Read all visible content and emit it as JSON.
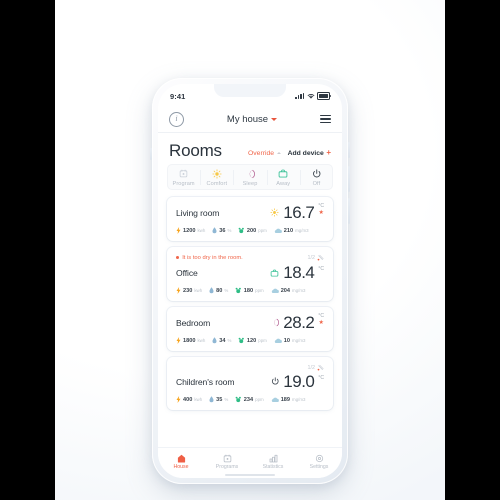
{
  "status_bar": {
    "time": "9:41",
    "signal_icon": "cellular-bars-icon",
    "wifi_icon": "wifi-icon",
    "battery_icon": "battery-icon"
  },
  "app_header": {
    "info_icon": "info-icon",
    "info_glyph": "i",
    "title": "My house",
    "chevron_icon": "chevron-down-icon",
    "menu_icon": "hamburger-menu-icon"
  },
  "page": {
    "title": "Rooms",
    "override_label": "Override",
    "override_chevron": "chevron-up-icon",
    "add_device_label": "Add device",
    "add_device_plus": "+"
  },
  "modes": [
    {
      "label": "Program",
      "icon": "calendar-icon",
      "color": "#c8cfd8"
    },
    {
      "label": "Comfort",
      "icon": "sun-icon",
      "color": "#f7c948"
    },
    {
      "label": "Sleep",
      "icon": "moon-icon",
      "color": "#b05a8e"
    },
    {
      "label": "Away",
      "icon": "briefcase-icon",
      "color": "#3fc39a"
    },
    {
      "label": "Off",
      "icon": "power-icon",
      "color": "#3a434d"
    }
  ],
  "rooms": [
    {
      "name": "Living room",
      "mode_icon": "sun-icon",
      "mode_color": "#f7c948",
      "temperature": "16.7",
      "unit": "°C",
      "heating": true,
      "metrics": [
        {
          "icon": "lightning-icon",
          "value": "1200",
          "unit": "kwh"
        },
        {
          "icon": "droplet-icon",
          "value": "36",
          "unit": "%"
        },
        {
          "icon": "co2-icon",
          "value": "200",
          "unit": "ppm"
        },
        {
          "icon": "cloud-icon",
          "value": "210",
          "unit": "mg/m3"
        }
      ]
    },
    {
      "name": "Office",
      "warning": "It is too dry in the room.",
      "badge": "1/2",
      "badge_icon": "signal-alert-icon",
      "mode_icon": "briefcase-icon",
      "mode_color": "#3fc39a",
      "temperature": "18.4",
      "unit": "°C",
      "heating": false,
      "metrics": [
        {
          "icon": "lightning-icon",
          "value": "230",
          "unit": "kwh"
        },
        {
          "icon": "droplet-icon",
          "value": "80",
          "unit": "%"
        },
        {
          "icon": "co2-icon",
          "value": "180",
          "unit": "ppm"
        },
        {
          "icon": "cloud-icon",
          "value": "204",
          "unit": "mg/m3"
        }
      ]
    },
    {
      "name": "Bedroom",
      "mode_icon": "moon-icon",
      "mode_color": "#b05a8e",
      "temperature": "28.2",
      "unit": "°C",
      "heating": true,
      "metrics": [
        {
          "icon": "lightning-icon",
          "value": "1800",
          "unit": "kwh"
        },
        {
          "icon": "droplet-icon",
          "value": "34",
          "unit": "%"
        },
        {
          "icon": "co2-icon",
          "value": "120",
          "unit": "ppm"
        },
        {
          "icon": "cloud-icon",
          "value": "10",
          "unit": "mg/m3"
        }
      ]
    },
    {
      "name": "Children's room",
      "badge": "1/2",
      "badge_icon": "signal-alert-icon",
      "mode_icon": "power-icon",
      "mode_color": "#3a434d",
      "temperature": "19.0",
      "unit": "°C",
      "heating": false,
      "metrics": [
        {
          "icon": "lightning-icon",
          "value": "400",
          "unit": "kwh"
        },
        {
          "icon": "droplet-icon",
          "value": "35",
          "unit": "%"
        },
        {
          "icon": "co2-icon",
          "value": "234",
          "unit": "ppm"
        },
        {
          "icon": "cloud-icon",
          "value": "189",
          "unit": "mg/m3"
        }
      ]
    }
  ],
  "tabbar": [
    {
      "label": "House",
      "icon": "house-icon",
      "active": true
    },
    {
      "label": "Programs",
      "icon": "calendar-icon",
      "active": false
    },
    {
      "label": "Statistics",
      "icon": "bar-chart-icon",
      "active": false
    },
    {
      "label": "Settings",
      "icon": "gear-icon",
      "active": false
    }
  ],
  "colors": {
    "accent": "#ef5f45",
    "warning": "#f0664a",
    "text": "#2b343d",
    "muted": "#b6bdc6",
    "energy": "#f7a51e",
    "humidity": "#8fb7d4",
    "co2": "#2fbd86",
    "air": "#a8cfe0"
  }
}
